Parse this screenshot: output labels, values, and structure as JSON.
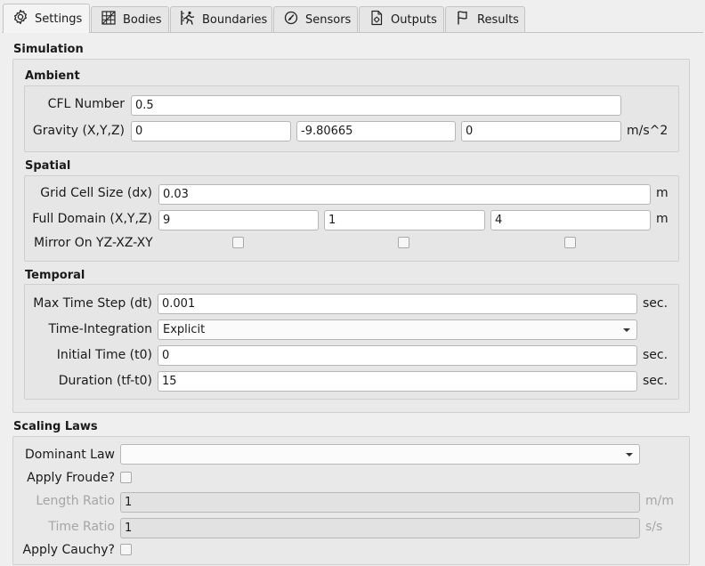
{
  "tabs": [
    {
      "label": "Settings",
      "icon": "gear-icon"
    },
    {
      "label": "Bodies",
      "icon": "grid-icon"
    },
    {
      "label": "Boundaries",
      "icon": "runner-icon"
    },
    {
      "label": "Sensors",
      "icon": "gauge-icon"
    },
    {
      "label": "Outputs",
      "icon": "file-gear-icon"
    },
    {
      "label": "Results",
      "icon": "flag-icon"
    }
  ],
  "simulation": {
    "title": "Simulation",
    "ambient": {
      "title": "Ambient",
      "cfl_label": "CFL Number",
      "cfl_value": "0.5",
      "gravity_label": "Gravity (X,Y,Z)",
      "gravity_x": "0",
      "gravity_y": "-9.80665",
      "gravity_z": "0",
      "gravity_unit": "m/s^2"
    },
    "spatial": {
      "title": "Spatial",
      "dx_label": "Grid Cell Size (dx)",
      "dx_value": "0.03",
      "dx_unit": "m",
      "domain_label": "Full Domain (X,Y,Z)",
      "domain_x": "9",
      "domain_y": "1",
      "domain_z": "4",
      "domain_unit": "m",
      "mirror_label": "Mirror On YZ-XZ-XY",
      "mirror_checked": [
        false,
        false,
        false
      ]
    },
    "temporal": {
      "title": "Temporal",
      "dt_label": "Max Time Step (dt)",
      "dt_value": "0.001",
      "dt_unit": "sec.",
      "integration_label": "Time-Integration",
      "integration_value": "Explicit",
      "t0_label": "Initial Time (t0)",
      "t0_value": "0",
      "t0_unit": "sec.",
      "duration_label": "Duration (tf-t0)",
      "duration_value": "15",
      "duration_unit": "sec."
    }
  },
  "scaling": {
    "title": "Scaling Laws",
    "dominant_label": "Dominant Law",
    "dominant_value": "",
    "froude_label": "Apply Froude?",
    "froude_checked": false,
    "length_label": "Length Ratio",
    "length_value": "1",
    "length_unit": "m/m",
    "time_label": "Time Ratio",
    "time_value": "1",
    "time_unit": "s/s",
    "cauchy_label": "Apply Cauchy?",
    "cauchy_checked": false
  },
  "colors": {
    "background": "#efefef",
    "group": "#e9e9e9",
    "field": "#ffffff",
    "disabled_text": "#a5a5a5"
  }
}
